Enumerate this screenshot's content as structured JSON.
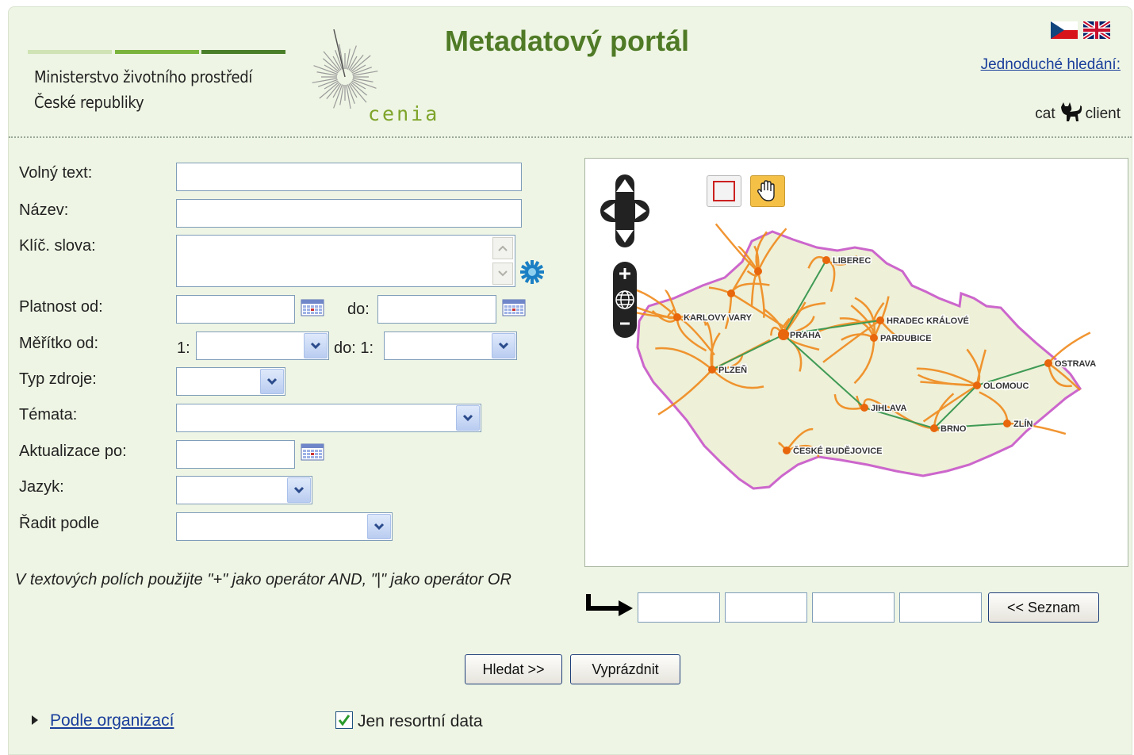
{
  "header": {
    "ministry_line1": "Ministerstvo životního prostředí",
    "ministry_line2": "České republiky",
    "cenia_logo_text": "cenia",
    "title": "Metadatový portál",
    "simple_search_link": "Jednoduché hledání:",
    "cat_label": "cat",
    "client_label": "client",
    "flags": [
      "cz-flag-icon",
      "uk-flag-icon"
    ],
    "colors": {
      "title": "#4f7a26",
      "link": "#1a3e9b",
      "stripe": "#7ab43c"
    }
  },
  "form": {
    "free_text_label": "Volný text:",
    "name_label": "Název:",
    "keywords_label": "Klíč. slova:",
    "valid_from_label": "Platnost od:",
    "valid_to_label": "do:",
    "scale_from_label": "Měřítko od:",
    "scale_from_prefix": "1:",
    "scale_to_label": "do: 1:",
    "resource_type_label": "Typ zdroje:",
    "topics_label": "Témata:",
    "updated_after_label": "Aktualizace po:",
    "language_label": "Jazyk:",
    "sort_by_label": "Řadit podle",
    "hint": "V textových polích použijte \"+\" jako operátor AND, \"|\" jako operátor OR"
  },
  "map": {
    "cities": [
      "LIBEREC",
      "KARLOVY VARY",
      "HRADEC KRÁLOVÉ",
      "PRAHA",
      "PARDUBICE",
      "OSTRAVA",
      "PLZEŇ",
      "OLOMOUC",
      "JIHLAVA",
      "ZLÍN",
      "BRNO",
      "ČESKÉ BUDĚJOVICE"
    ],
    "colors": {
      "roads": "#f08a1c",
      "highways": "#3f9a55",
      "land": "#eef0d7",
      "border": "#cc66cc",
      "city": "#e8660c"
    }
  },
  "bbox": {
    "values": [
      "",
      "",
      "",
      ""
    ],
    "list_button": "<< Seznam"
  },
  "actions": {
    "search_button": "Hledat >>",
    "clear_button": "Vyprázdnit"
  },
  "footer": {
    "by_org_link": "Podle organizací",
    "resort_only_label": "Jen resortní data",
    "resort_only_checked": true
  }
}
